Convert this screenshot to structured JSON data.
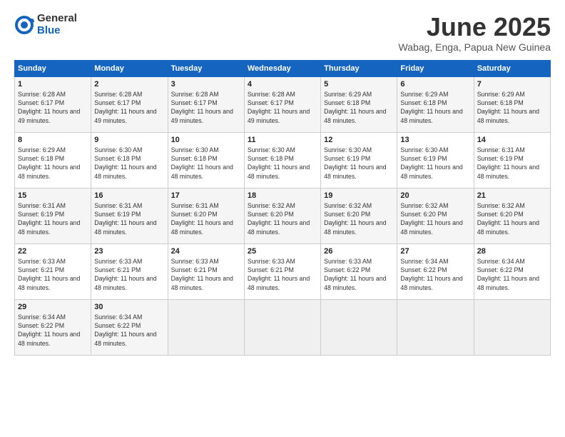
{
  "header": {
    "logo_general": "General",
    "logo_blue": "Blue",
    "month_title": "June 2025",
    "location": "Wabag, Enga, Papua New Guinea"
  },
  "days_of_week": [
    "Sunday",
    "Monday",
    "Tuesday",
    "Wednesday",
    "Thursday",
    "Friday",
    "Saturday"
  ],
  "weeks": [
    [
      {
        "day": "1",
        "sunrise": "6:28 AM",
        "sunset": "6:17 PM",
        "daylight": "11 hours and 49 minutes."
      },
      {
        "day": "2",
        "sunrise": "6:28 AM",
        "sunset": "6:17 PM",
        "daylight": "11 hours and 49 minutes."
      },
      {
        "day": "3",
        "sunrise": "6:28 AM",
        "sunset": "6:17 PM",
        "daylight": "11 hours and 49 minutes."
      },
      {
        "day": "4",
        "sunrise": "6:28 AM",
        "sunset": "6:17 PM",
        "daylight": "11 hours and 49 minutes."
      },
      {
        "day": "5",
        "sunrise": "6:29 AM",
        "sunset": "6:18 PM",
        "daylight": "11 hours and 48 minutes."
      },
      {
        "day": "6",
        "sunrise": "6:29 AM",
        "sunset": "6:18 PM",
        "daylight": "11 hours and 48 minutes."
      },
      {
        "day": "7",
        "sunrise": "6:29 AM",
        "sunset": "6:18 PM",
        "daylight": "11 hours and 48 minutes."
      }
    ],
    [
      {
        "day": "8",
        "sunrise": "6:29 AM",
        "sunset": "6:18 PM",
        "daylight": "11 hours and 48 minutes."
      },
      {
        "day": "9",
        "sunrise": "6:30 AM",
        "sunset": "6:18 PM",
        "daylight": "11 hours and 48 minutes."
      },
      {
        "day": "10",
        "sunrise": "6:30 AM",
        "sunset": "6:18 PM",
        "daylight": "11 hours and 48 minutes."
      },
      {
        "day": "11",
        "sunrise": "6:30 AM",
        "sunset": "6:18 PM",
        "daylight": "11 hours and 48 minutes."
      },
      {
        "day": "12",
        "sunrise": "6:30 AM",
        "sunset": "6:19 PM",
        "daylight": "11 hours and 48 minutes."
      },
      {
        "day": "13",
        "sunrise": "6:30 AM",
        "sunset": "6:19 PM",
        "daylight": "11 hours and 48 minutes."
      },
      {
        "day": "14",
        "sunrise": "6:31 AM",
        "sunset": "6:19 PM",
        "daylight": "11 hours and 48 minutes."
      }
    ],
    [
      {
        "day": "15",
        "sunrise": "6:31 AM",
        "sunset": "6:19 PM",
        "daylight": "11 hours and 48 minutes."
      },
      {
        "day": "16",
        "sunrise": "6:31 AM",
        "sunset": "6:19 PM",
        "daylight": "11 hours and 48 minutes."
      },
      {
        "day": "17",
        "sunrise": "6:31 AM",
        "sunset": "6:20 PM",
        "daylight": "11 hours and 48 minutes."
      },
      {
        "day": "18",
        "sunrise": "6:32 AM",
        "sunset": "6:20 PM",
        "daylight": "11 hours and 48 minutes."
      },
      {
        "day": "19",
        "sunrise": "6:32 AM",
        "sunset": "6:20 PM",
        "daylight": "11 hours and 48 minutes."
      },
      {
        "day": "20",
        "sunrise": "6:32 AM",
        "sunset": "6:20 PM",
        "daylight": "11 hours and 48 minutes."
      },
      {
        "day": "21",
        "sunrise": "6:32 AM",
        "sunset": "6:20 PM",
        "daylight": "11 hours and 48 minutes."
      }
    ],
    [
      {
        "day": "22",
        "sunrise": "6:33 AM",
        "sunset": "6:21 PM",
        "daylight": "11 hours and 48 minutes."
      },
      {
        "day": "23",
        "sunrise": "6:33 AM",
        "sunset": "6:21 PM",
        "daylight": "11 hours and 48 minutes."
      },
      {
        "day": "24",
        "sunrise": "6:33 AM",
        "sunset": "6:21 PM",
        "daylight": "11 hours and 48 minutes."
      },
      {
        "day": "25",
        "sunrise": "6:33 AM",
        "sunset": "6:21 PM",
        "daylight": "11 hours and 48 minutes."
      },
      {
        "day": "26",
        "sunrise": "6:33 AM",
        "sunset": "6:22 PM",
        "daylight": "11 hours and 48 minutes."
      },
      {
        "day": "27",
        "sunrise": "6:34 AM",
        "sunset": "6:22 PM",
        "daylight": "11 hours and 48 minutes."
      },
      {
        "day": "28",
        "sunrise": "6:34 AM",
        "sunset": "6:22 PM",
        "daylight": "11 hours and 48 minutes."
      }
    ],
    [
      {
        "day": "29",
        "sunrise": "6:34 AM",
        "sunset": "6:22 PM",
        "daylight": "11 hours and 48 minutes."
      },
      {
        "day": "30",
        "sunrise": "6:34 AM",
        "sunset": "6:22 PM",
        "daylight": "11 hours and 48 minutes."
      },
      null,
      null,
      null,
      null,
      null
    ]
  ]
}
